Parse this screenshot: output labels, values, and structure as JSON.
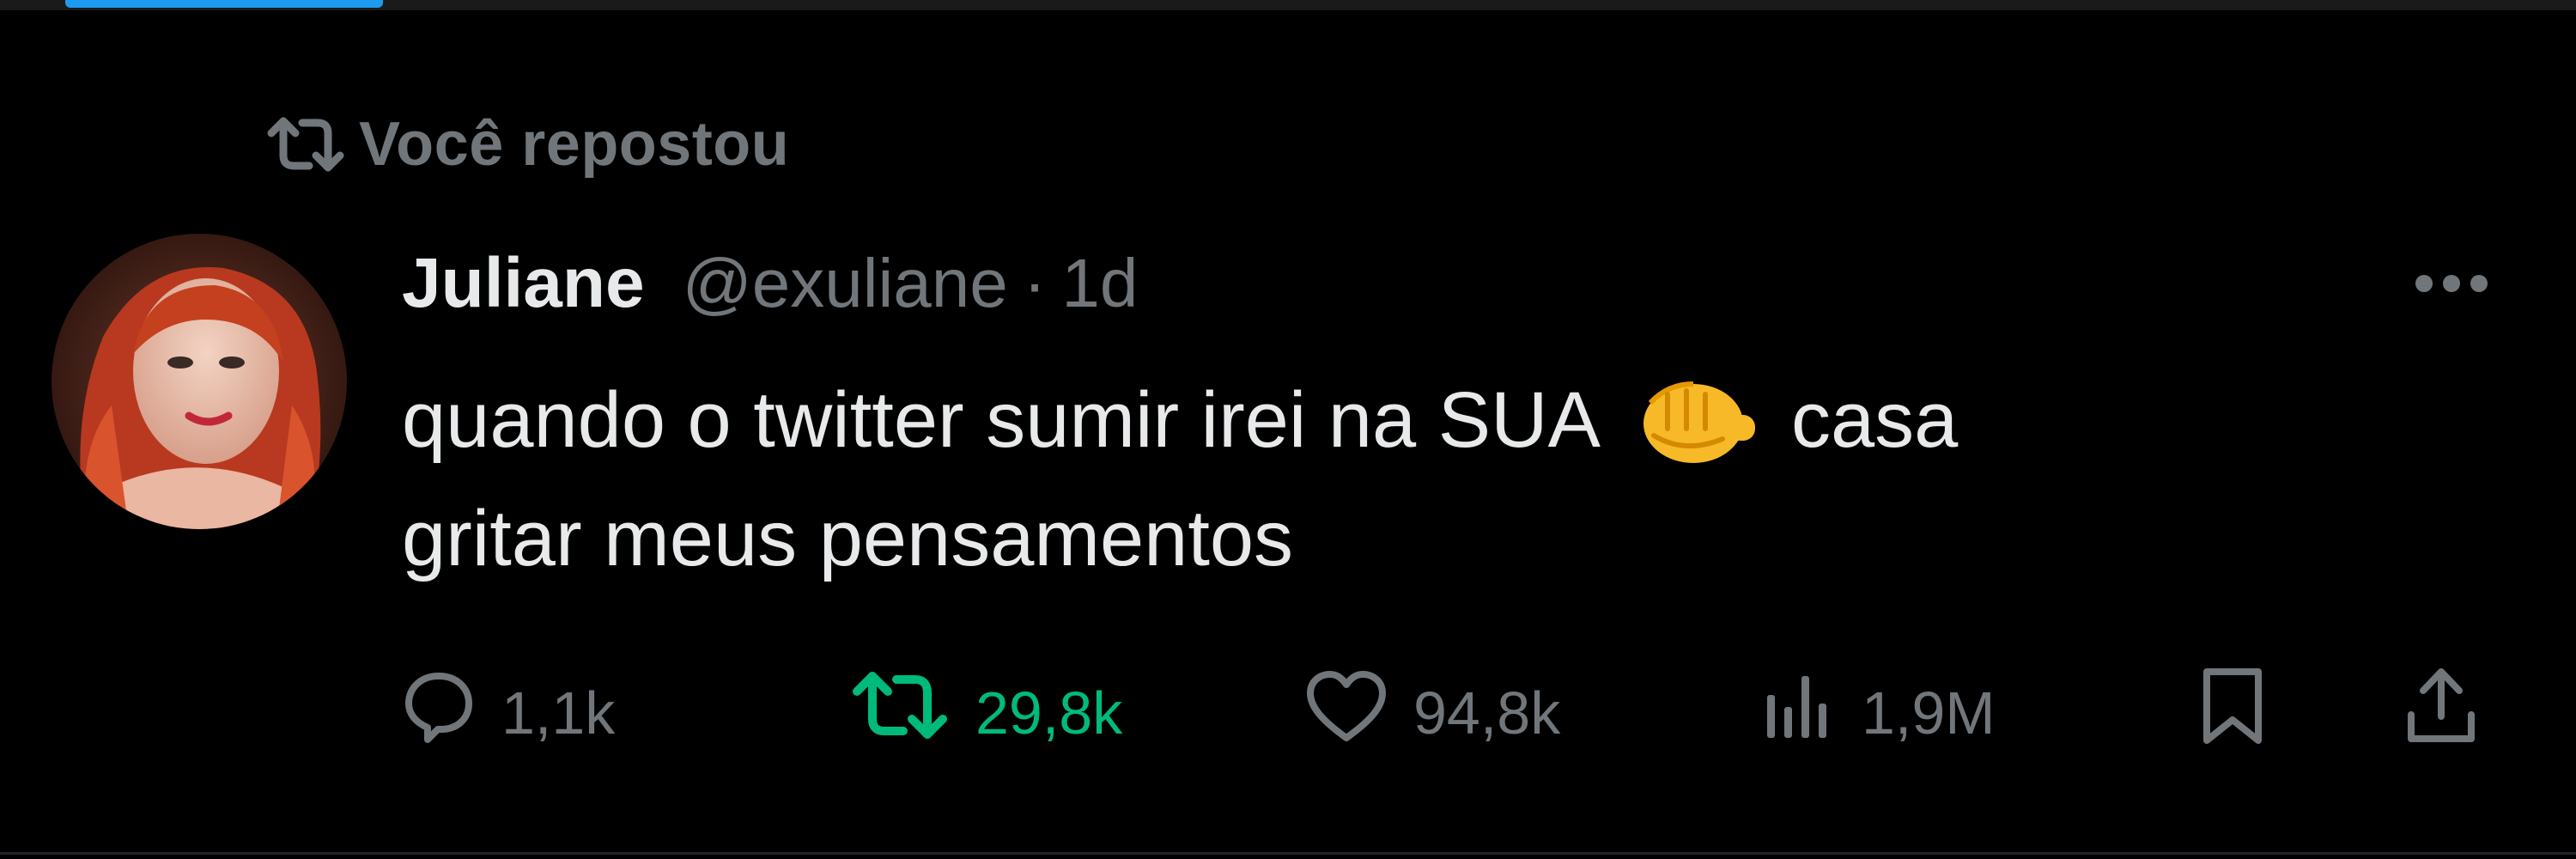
{
  "context": {
    "label": "Você repostou"
  },
  "tweet": {
    "author_name": "Juliane",
    "author_handle": "@exuliane",
    "separator": "·",
    "time": "1d",
    "text_line1_before": "quando o twitter sumir irei na SUA",
    "text_emoji": "👊",
    "text_line1_after": "casa",
    "text_line2": "gritar meus pensamentos"
  },
  "actions": {
    "replies": "1,1k",
    "reposts": "29,8k",
    "likes": "94,8k",
    "views": "1,9M"
  },
  "icons": {
    "context": "repost-icon",
    "reply": "reply-icon",
    "repost": "repost-icon",
    "like": "heart-icon",
    "views": "views-icon",
    "bookmark": "bookmark-icon",
    "share": "share-icon",
    "more": "more-icon"
  },
  "colors": {
    "background": "#000000",
    "text_primary": "#e7e9ea",
    "text_secondary": "#71767b",
    "repost_active": "#00ba7c",
    "accent": "#1d9bf0"
  }
}
